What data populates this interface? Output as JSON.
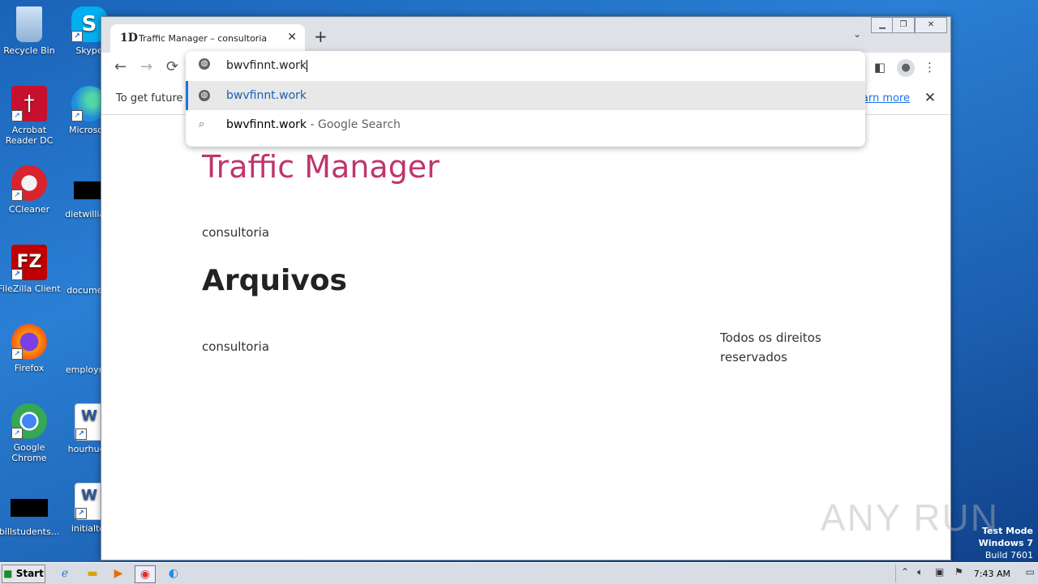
{
  "desktop_icons": [
    {
      "label": "Recycle Bin",
      "icon": "recycle-bin-icon"
    },
    {
      "label": "Acrobat Reader DC",
      "icon": "acrobat-icon"
    },
    {
      "label": "CCleaner",
      "icon": "ccleaner-icon"
    },
    {
      "label": "FileZilla Client",
      "icon": "filezilla-icon"
    },
    {
      "label": "Firefox",
      "icon": "firefox-icon"
    },
    {
      "label": "Google Chrome",
      "icon": "chrome-icon"
    },
    {
      "label": "billstudents...",
      "icon": "file-icon"
    },
    {
      "label": "Skype",
      "icon": "skype-icon"
    },
    {
      "label": "Microsoft",
      "icon": "edge-icon"
    },
    {
      "label": "dietwilliam",
      "icon": "file-icon"
    },
    {
      "label": "document",
      "icon": "file-icon"
    },
    {
      "label": "employme",
      "icon": "file-icon"
    },
    {
      "label": "hourhuge",
      "icon": "word-doc-icon"
    },
    {
      "label": "initialtol",
      "icon": "word-doc-icon"
    }
  ],
  "browser": {
    "tab_title": "Traffic Manager – consultoria",
    "new_tab_symbol": "+",
    "omnibox_text": "bwvfinnt.work",
    "suggestions": [
      {
        "text": "bwvfinnt.work",
        "suffix": ""
      },
      {
        "text": "bwvfinnt.work",
        "suffix": " - Google Search"
      }
    ],
    "infobar": {
      "text": "To get future G",
      "link": "earn more"
    }
  },
  "page": {
    "site_title": "Traffic Manager",
    "tagline": "consultoria",
    "heading": "Arquivos",
    "footer_left": "consultoria",
    "footer_right": "Todos os direitos reservados"
  },
  "watermark": "ANY RUN",
  "system": {
    "test_mode_line1": "Test Mode",
    "test_mode_line2": "Windows 7",
    "build": "Build 7601",
    "clock": "7:43 AM",
    "start_label": "Start"
  },
  "colors": {
    "title_accent": "#c0356c",
    "link": "#1a73e8",
    "selected_suggestion": "#1a5fb4"
  }
}
